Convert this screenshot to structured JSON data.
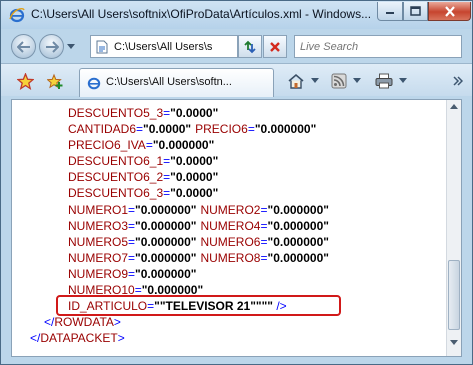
{
  "window": {
    "title": "C:\\Users\\All Users\\softnix\\OfiProData\\Artículos.xml - Windows..."
  },
  "navbar": {
    "address": "C:\\Users\\All Users\\s",
    "search_placeholder": "Live Search"
  },
  "tabbar": {
    "active_tab_label": "C:\\Users\\All Users\\softn..."
  },
  "document": {
    "attribute_lines": [
      {
        "indent": 56,
        "pairs": [
          {
            "name": "DESCUENTO5_3",
            "value": "\"0.0000\""
          }
        ]
      },
      {
        "indent": 56,
        "pairs": [
          {
            "name": "CANTIDAD6",
            "value": "\"0.0000\""
          },
          {
            "name": "PRECIO6",
            "value": "\"0.000000\""
          }
        ]
      },
      {
        "indent": 56,
        "pairs": [
          {
            "name": "PRECIO6_IVA",
            "value": "\"0.000000\""
          }
        ]
      },
      {
        "indent": 56,
        "pairs": [
          {
            "name": "DESCUENTO6_1",
            "value": "\"0.0000\""
          }
        ]
      },
      {
        "indent": 56,
        "pairs": [
          {
            "name": "DESCUENTO6_2",
            "value": "\"0.0000\""
          }
        ]
      },
      {
        "indent": 56,
        "pairs": [
          {
            "name": "DESCUENTO6_3",
            "value": "\"0.0000\""
          }
        ]
      },
      {
        "indent": 56,
        "pairs": [
          {
            "name": "NUMERO1",
            "value": "\"0.000000\""
          },
          {
            "name": "NUMERO2",
            "value": "\"0.000000\""
          }
        ]
      },
      {
        "indent": 56,
        "pairs": [
          {
            "name": "NUMERO3",
            "value": "\"0.000000\""
          },
          {
            "name": "NUMERO4",
            "value": "\"0.000000\""
          }
        ]
      },
      {
        "indent": 56,
        "pairs": [
          {
            "name": "NUMERO5",
            "value": "\"0.000000\""
          },
          {
            "name": "NUMERO6",
            "value": "\"0.000000\""
          }
        ]
      },
      {
        "indent": 56,
        "pairs": [
          {
            "name": "NUMERO7",
            "value": "\"0.000000\""
          },
          {
            "name": "NUMERO8",
            "value": "\"0.000000\""
          }
        ]
      },
      {
        "indent": 56,
        "pairs": [
          {
            "name": "NUMERO9",
            "value": "\"0.000000\""
          }
        ]
      },
      {
        "indent": 56,
        "pairs": [
          {
            "name": "NUMERO10",
            "value": "\"0.000000\""
          }
        ]
      }
    ],
    "highlighted_line": {
      "name": "ID_ARTICULO",
      "value": "\"\"TELEVISOR 21\"\"\"\"",
      "close": " />"
    },
    "closing_tags": [
      {
        "indent": 32,
        "open": "</",
        "name": "ROWDATA",
        "close": ">"
      },
      {
        "indent": 18,
        "open": "</",
        "name": "DATAPACKET",
        "close": ">"
      }
    ],
    "highlight_color": "#d11919"
  },
  "colors": {
    "attribute_name": "#990000",
    "markup": "#0000ff",
    "attribute_value": "#000000"
  }
}
